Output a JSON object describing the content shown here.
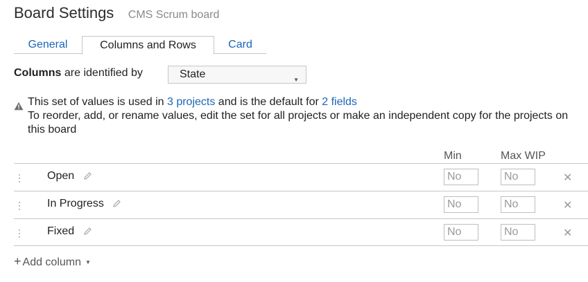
{
  "header": {
    "title": "Board Settings",
    "subtitle": "CMS Scrum board"
  },
  "tabs": [
    {
      "label": "General",
      "active": false
    },
    {
      "label": "Columns and Rows",
      "active": true
    },
    {
      "label": "Card",
      "active": false
    }
  ],
  "identify": {
    "label_bold": "Columns",
    "label_rest": " are identified by",
    "selected": "State"
  },
  "info": {
    "line1_prefix": "This set of values is used in ",
    "projects_link": "3 projects",
    "line1_middle": " and is the default for ",
    "fields_link": "2 fields",
    "line2": "To reorder, add, or rename values, edit the set for all projects or make an independent copy for the projects on this board"
  },
  "columns_header": {
    "min": "Min",
    "max": "Max WIP"
  },
  "rows": [
    {
      "name": "Open",
      "min_placeholder": "No",
      "max_placeholder": "No"
    },
    {
      "name": "In Progress",
      "min_placeholder": "No",
      "max_placeholder": "No"
    },
    {
      "name": "Fixed",
      "min_placeholder": "No",
      "max_placeholder": "No"
    }
  ],
  "add_column": {
    "plus": "+",
    "label": "Add column"
  },
  "icons": {
    "warning": "warning-icon",
    "pencil": "pencil-icon",
    "close": "close-icon",
    "grip": "drag-handle-icon",
    "caret": "caret-down-icon"
  },
  "colors": {
    "link": "#1a66b8",
    "border": "#c6c6c6",
    "muted": "#8a8a8a"
  }
}
